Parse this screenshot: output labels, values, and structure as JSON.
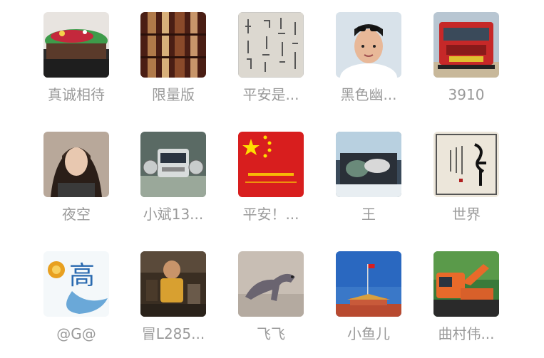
{
  "contacts": [
    {
      "name": "真诚相待",
      "avatar_icon": "cake-photo-avatar"
    },
    {
      "name": "限量版",
      "avatar_icon": "bamboo-photo-avatar"
    },
    {
      "name": "平安是...",
      "avatar_icon": "calligraphy-paper-avatar"
    },
    {
      "name": "黑色幽...",
      "avatar_icon": "young-man-sunglasses-avatar"
    },
    {
      "name": "3910",
      "avatar_icon": "red-truck-avatar"
    },
    {
      "name": "夜空",
      "avatar_icon": "woman-portrait-avatar"
    },
    {
      "name": "小斌13...",
      "avatar_icon": "silver-truck-avatar"
    },
    {
      "name": "平安！...",
      "avatar_icon": "china-flag-avatar"
    },
    {
      "name": "王",
      "avatar_icon": "painting-avatar"
    },
    {
      "name": "世界",
      "avatar_icon": "calligraphy-scroll-avatar"
    },
    {
      "name": "@G@",
      "avatar_icon": "gao-character-avatar"
    },
    {
      "name": "冒L285...",
      "avatar_icon": "child-photo-avatar"
    },
    {
      "name": "飞飞",
      "avatar_icon": "dinosaur-toy-avatar"
    },
    {
      "name": "小鱼儿",
      "avatar_icon": "tiananmen-avatar"
    },
    {
      "name": "曲村伟...",
      "avatar_icon": "excavator-avatar"
    }
  ]
}
